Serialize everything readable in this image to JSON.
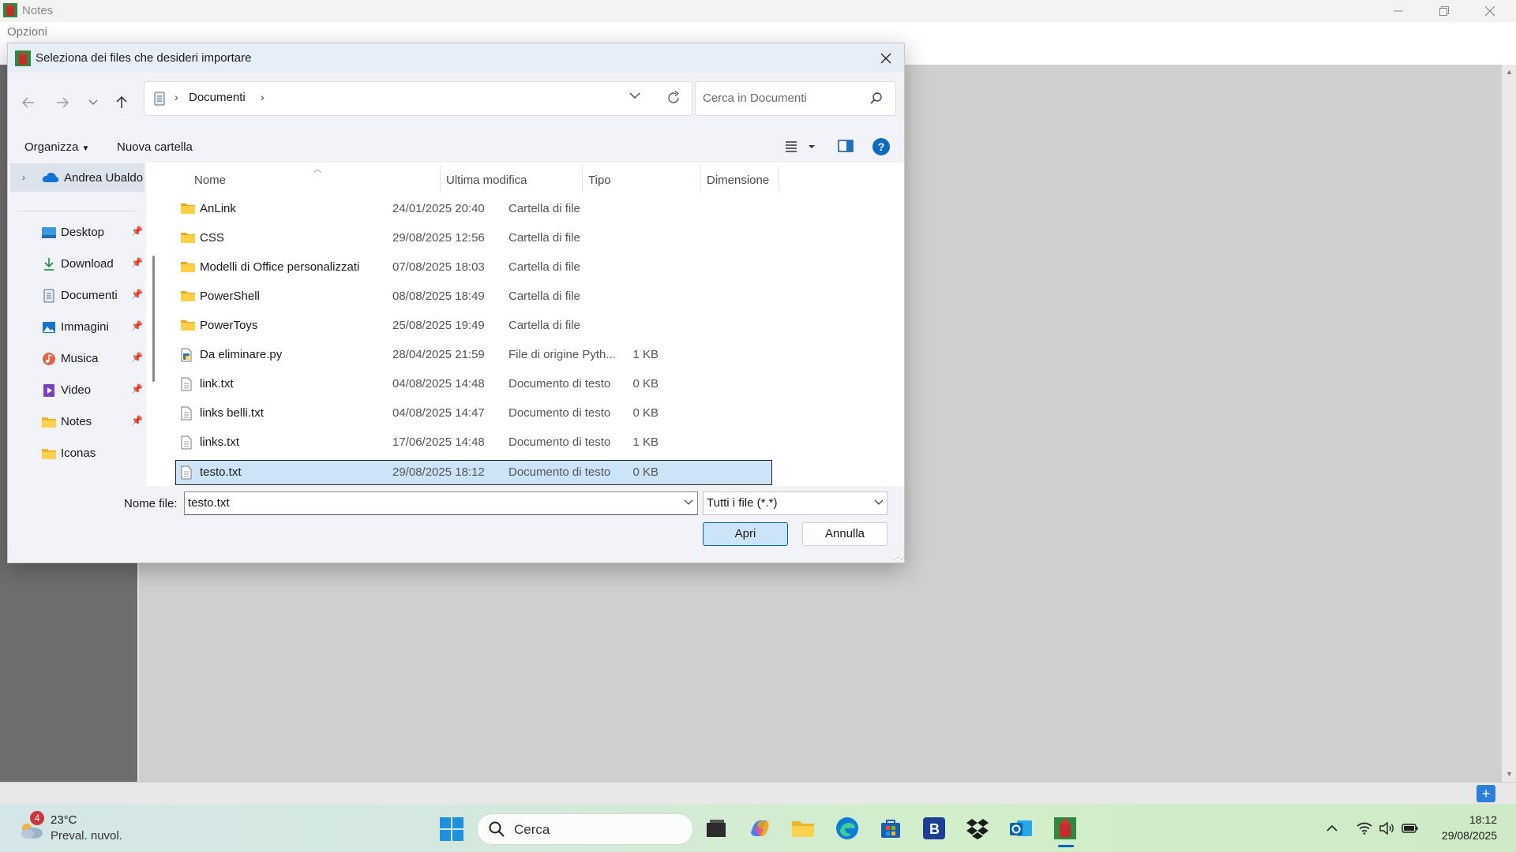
{
  "app": {
    "title": "Notes",
    "menu": {
      "opzioni": "Opzioni"
    }
  },
  "dialog": {
    "title": "Seleziona dei files che desideri importare",
    "address": {
      "segment": "Documenti"
    },
    "search": {
      "placeholder": "Cerca in Documenti"
    },
    "commands": {
      "organizza": "Organizza",
      "nuova_cartella": "Nuova cartella"
    },
    "nav": {
      "onedrive": "Andrea Ubaldo",
      "items": [
        {
          "label": "Desktop",
          "icon": "desktop-icon",
          "pinned": true
        },
        {
          "label": "Download",
          "icon": "download-icon",
          "pinned": true
        },
        {
          "label": "Documenti",
          "icon": "documents-icon",
          "pinned": true
        },
        {
          "label": "Immagini",
          "icon": "pictures-icon",
          "pinned": true
        },
        {
          "label": "Musica",
          "icon": "music-icon",
          "pinned": true
        },
        {
          "label": "Video",
          "icon": "video-icon",
          "pinned": true
        },
        {
          "label": "Notes",
          "icon": "folder-icon",
          "pinned": true
        },
        {
          "label": "Iconas",
          "icon": "folder-icon",
          "pinned": false
        }
      ]
    },
    "columns": {
      "name": "Nome",
      "modified": "Ultima modifica",
      "type": "Tipo",
      "size": "Dimensione"
    },
    "files": [
      {
        "name": "AnLink",
        "modified": "24/01/2025 20:40",
        "type": "Cartella di file",
        "size": "",
        "kind": "folder"
      },
      {
        "name": "CSS",
        "modified": "29/08/2025 12:56",
        "type": "Cartella di file",
        "size": "",
        "kind": "folder"
      },
      {
        "name": "Modelli di Office personalizzati",
        "modified": "07/08/2025 18:03",
        "type": "Cartella di file",
        "size": "",
        "kind": "folder"
      },
      {
        "name": "PowerShell",
        "modified": "08/08/2025 18:49",
        "type": "Cartella di file",
        "size": "",
        "kind": "folder"
      },
      {
        "name": "PowerToys",
        "modified": "25/08/2025 19:49",
        "type": "Cartella di file",
        "size": "",
        "kind": "folder"
      },
      {
        "name": "Da eliminare.py",
        "modified": "28/04/2025 21:59",
        "type": "File di origine Pyth...",
        "size": "1 KB",
        "kind": "python"
      },
      {
        "name": "link.txt",
        "modified": "04/08/2025 14:48",
        "type": "Documento di testo",
        "size": "0 KB",
        "kind": "text"
      },
      {
        "name": "links belli.txt",
        "modified": "04/08/2025 14:47",
        "type": "Documento di testo",
        "size": "0 KB",
        "kind": "text"
      },
      {
        "name": "links.txt",
        "modified": "17/06/2025 14:48",
        "type": "Documento di testo",
        "size": "1 KB",
        "kind": "text"
      },
      {
        "name": "testo.txt",
        "modified": "29/08/2025 18:12",
        "type": "Documento di testo",
        "size": "0 KB",
        "kind": "text",
        "selected": true
      }
    ],
    "filename_label": "Nome file:",
    "filename_value": "testo.txt",
    "filetype_value": "Tutti i file (*.*)",
    "buttons": {
      "open": "Apri",
      "cancel": "Annulla"
    }
  },
  "taskbar": {
    "weather": {
      "badge": "4",
      "temp": "23°C",
      "desc": "Preval. nuvol."
    },
    "search_label": "Cerca",
    "time": "18:12",
    "date": "29/08/2025"
  },
  "colors": {
    "accent": "#0067c0",
    "selection": "#cce4f7",
    "folder": "#f8c33c"
  }
}
